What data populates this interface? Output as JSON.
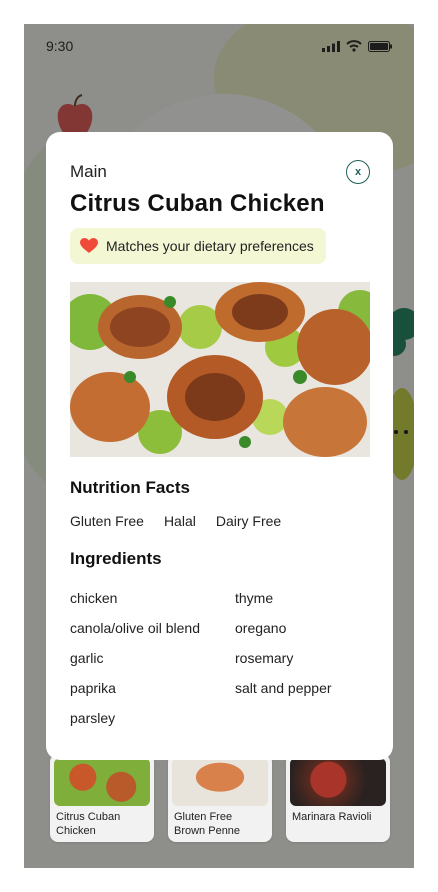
{
  "status_bar": {
    "time": "9:30"
  },
  "background_cards": [
    {
      "label": "Citrus Cuban Chicken"
    },
    {
      "label": "Gluten Free Brown Penne"
    },
    {
      "label": "Marinara Ravioli"
    }
  ],
  "modal": {
    "category": "Main",
    "close_label": "x",
    "title": "Citrus Cuban Chicken",
    "badge": {
      "icon": "heart-icon",
      "text": "Matches your dietary preferences",
      "color": "#f4f7d4"
    },
    "nutrition": {
      "heading": "Nutrition Facts",
      "tags": [
        "Gluten Free",
        "Halal",
        "Dairy Free"
      ]
    },
    "ingredients": {
      "heading": "Ingredients",
      "items": [
        "chicken",
        "thyme",
        "canola/olive oil blend",
        "oregano",
        "garlic",
        "rosemary",
        "paprika",
        "salt and pepper",
        "parsley"
      ]
    }
  },
  "colors": {
    "accent": "#1f5e59",
    "heart": "#f04b3a",
    "overlay": "rgba(0,0,0,0.42)"
  }
}
